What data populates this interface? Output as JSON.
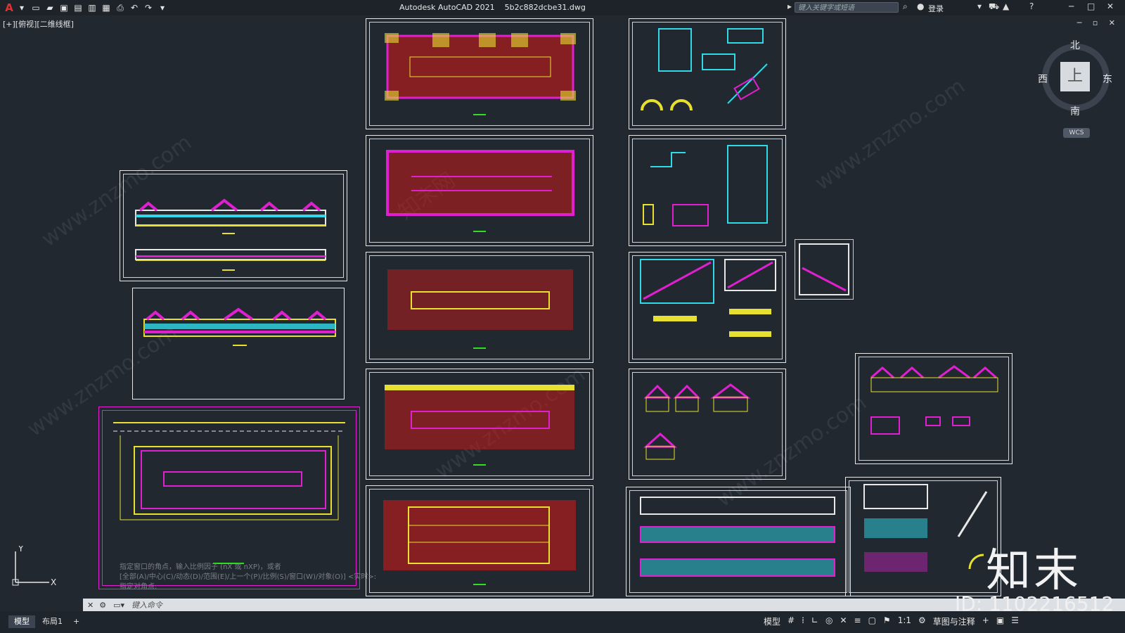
{
  "window": {
    "app_title": "Autodesk AutoCAD 2021",
    "file_name": "5b2c882dcbe31.dwg",
    "search_placeholder": "键入关键字或短语",
    "login_label": "登录"
  },
  "viewport": {
    "label": "[+][俯视][二维线框]",
    "compass": {
      "north": "北",
      "south": "南",
      "east": "东",
      "west": "西"
    },
    "cube_face": "上",
    "wcs_label": "WCS",
    "ucs_y": "Y",
    "ucs_x": "X"
  },
  "command": {
    "history": [
      "指定窗口的角点，输入比例因子 (nX 或 nXP)，或者",
      "[全部(A)/中心(C)/动态(D)/范围(E)/上一个(P)/比例(S)/窗口(W)/对象(O)] <实时>:",
      "指定对角点:"
    ],
    "placeholder": "键入命令"
  },
  "status": {
    "tab_model": "模型",
    "tab_layout1": "布局1",
    "add_tab": "+",
    "model_label": "模型",
    "scale": "1:1",
    "workspace": "草图与注释"
  },
  "watermarks": {
    "site": "www.znzmo.com",
    "brand": "知末网",
    "logo": "知末",
    "id": "ID: 1102216512"
  },
  "colors": {
    "background": "#212830",
    "magenta": "#e020d0",
    "red": "#d81818",
    "yellow": "#e8e030",
    "cyan": "#30d8e8",
    "white": "#e8e8e8"
  }
}
